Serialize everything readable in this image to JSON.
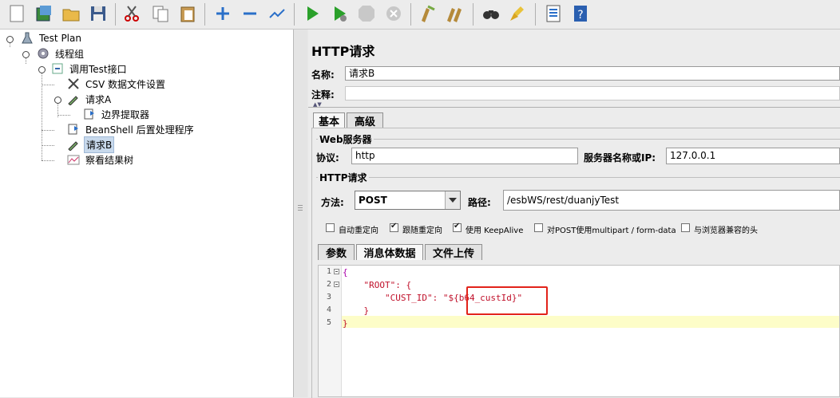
{
  "toolbar": {
    "icons": [
      "new-icon",
      "templates-icon",
      "open-icon",
      "save-icon",
      "cut-icon",
      "copy-icon",
      "paste-icon",
      "expand-icon",
      "collapse-icon",
      "toggle-icon",
      "start-icon",
      "start-no-pause-icon",
      "stop-icon",
      "shutdown-icon",
      "clear-icon",
      "clear-all-icon",
      "search-icon",
      "reset-search-icon",
      "function-helper-icon",
      "help-icon"
    ]
  },
  "tree": {
    "items": [
      {
        "label": "Test Plan",
        "icon": "flask-icon"
      },
      {
        "label": "线程组",
        "icon": "gear-icon"
      },
      {
        "label": "调用Test接口",
        "icon": "controller-icon"
      },
      {
        "label": "CSV 数据文件设置",
        "icon": "scissors-icon"
      },
      {
        "label": "请求A",
        "icon": "pipette-icon"
      },
      {
        "label": "边界提取器",
        "icon": "extractor-icon"
      },
      {
        "label": "BeanShell 后置处理程序",
        "icon": "postprocessor-icon"
      },
      {
        "label": "请求B",
        "icon": "pipette-icon"
      },
      {
        "label": "察看结果树",
        "icon": "chart-icon"
      }
    ]
  },
  "panel": {
    "title": "HTTP请求",
    "name_label": "名称:",
    "name_value": "请求B",
    "comment_label": "注释:",
    "tabs": [
      "基本",
      "高级"
    ],
    "web_server_title": "Web服务器",
    "protocol_label": "协议:",
    "protocol_value": "http",
    "server_label": "服务器名称或IP:",
    "server_value": "127.0.0.1",
    "http_request_title": "HTTP请求",
    "method_label": "方法:",
    "method_value": "POST",
    "path_label": "路径:",
    "path_value": "/esbWS/rest/duanjyTest",
    "checkboxes": [
      {
        "label": "自动重定向",
        "checked": false
      },
      {
        "label": "跟随重定向",
        "checked": true
      },
      {
        "label": "使用 KeepAlive",
        "checked": true
      },
      {
        "label": "对POST使用multipart / form-data",
        "checked": false
      },
      {
        "label": "与浏览器兼容的头",
        "checked": false
      }
    ],
    "sub_tabs": [
      "参数",
      "消息体数据",
      "文件上传"
    ]
  },
  "editor": {
    "lines": [
      {
        "num": "1",
        "text": "{"
      },
      {
        "num": "2",
        "text": "    \"ROOT\": {"
      },
      {
        "num": "3",
        "text": "        \"CUST_ID\": \"${b64_custId}\""
      },
      {
        "num": "4",
        "text": "    }"
      },
      {
        "num": "5",
        "text": "}"
      }
    ]
  }
}
